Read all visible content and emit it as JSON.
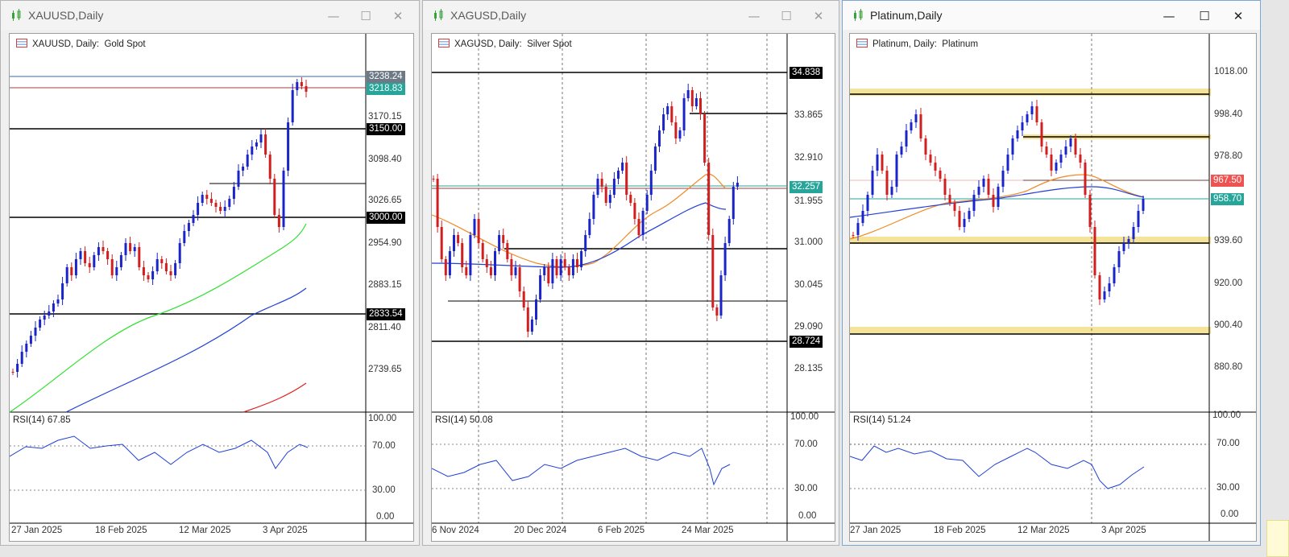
{
  "windows": [
    {
      "title": "XAUUSD,Daily",
      "label": "XAUUSD, Daily:  Gold Spot",
      "rsi": "RSI(14) 67.85",
      "scale": [
        "3170.15",
        "3098.40",
        "3026.65",
        "2954.90",
        "2883.15",
        "2811.40",
        "2739.65"
      ],
      "tags": [
        "3238.24",
        "3218.83",
        "3150.00",
        "3000.00",
        "2833.54"
      ],
      "rsi_scale": [
        "100.00",
        "70.00",
        "30.00",
        "0.00"
      ],
      "dates": [
        "27 Jan 2025",
        "18 Feb 2025",
        "12 Mar 2025",
        "3 Apr 2025"
      ]
    },
    {
      "title": "XAGUSD,Daily",
      "label": "XAGUSD, Daily:  Silver Spot",
      "rsi": "RSI(14) 50.08",
      "scale": [
        "33.865",
        "32.910",
        "31.955",
        "31.000",
        "30.045",
        "29.090",
        "28.135"
      ],
      "tags": [
        "34.838",
        "32.257",
        "28.724"
      ],
      "rsi_scale": [
        "100.00",
        "70.00",
        "30.00",
        "0.00"
      ],
      "dates": [
        "6 Nov 2024",
        "20 Dec 2024",
        "6 Feb 2025",
        "24 Mar 2025"
      ]
    },
    {
      "title": "Platinum,Daily",
      "label": "Platinum, Daily:  Platinum",
      "rsi": "RSI(14) 51.24",
      "scale": [
        "1018.00",
        "998.40",
        "978.80",
        "939.60",
        "920.00",
        "900.40",
        "880.80"
      ],
      "tags": [
        "967.50",
        "958.70"
      ],
      "rsi_scale": [
        "100.00",
        "70.00",
        "30.00",
        "0.00"
      ],
      "dates": [
        "27 Jan 2025",
        "18 Feb 2025",
        "12 Mar 2025",
        "3 Apr 2025"
      ]
    }
  ],
  "controls": {
    "minimize": "—",
    "maximize": "☐",
    "close": "✕"
  },
  "colors": {
    "bull": "#1a24c8",
    "bear": "#d11f1f",
    "ma_green": "#2fe02f",
    "ma_blue": "#1f3fd6",
    "ma_red": "#e02020",
    "ma_orange": "#f08a24",
    "rsi": "#1f3fd6",
    "zone": "#f5e39a",
    "teal": "#26a69a"
  }
}
